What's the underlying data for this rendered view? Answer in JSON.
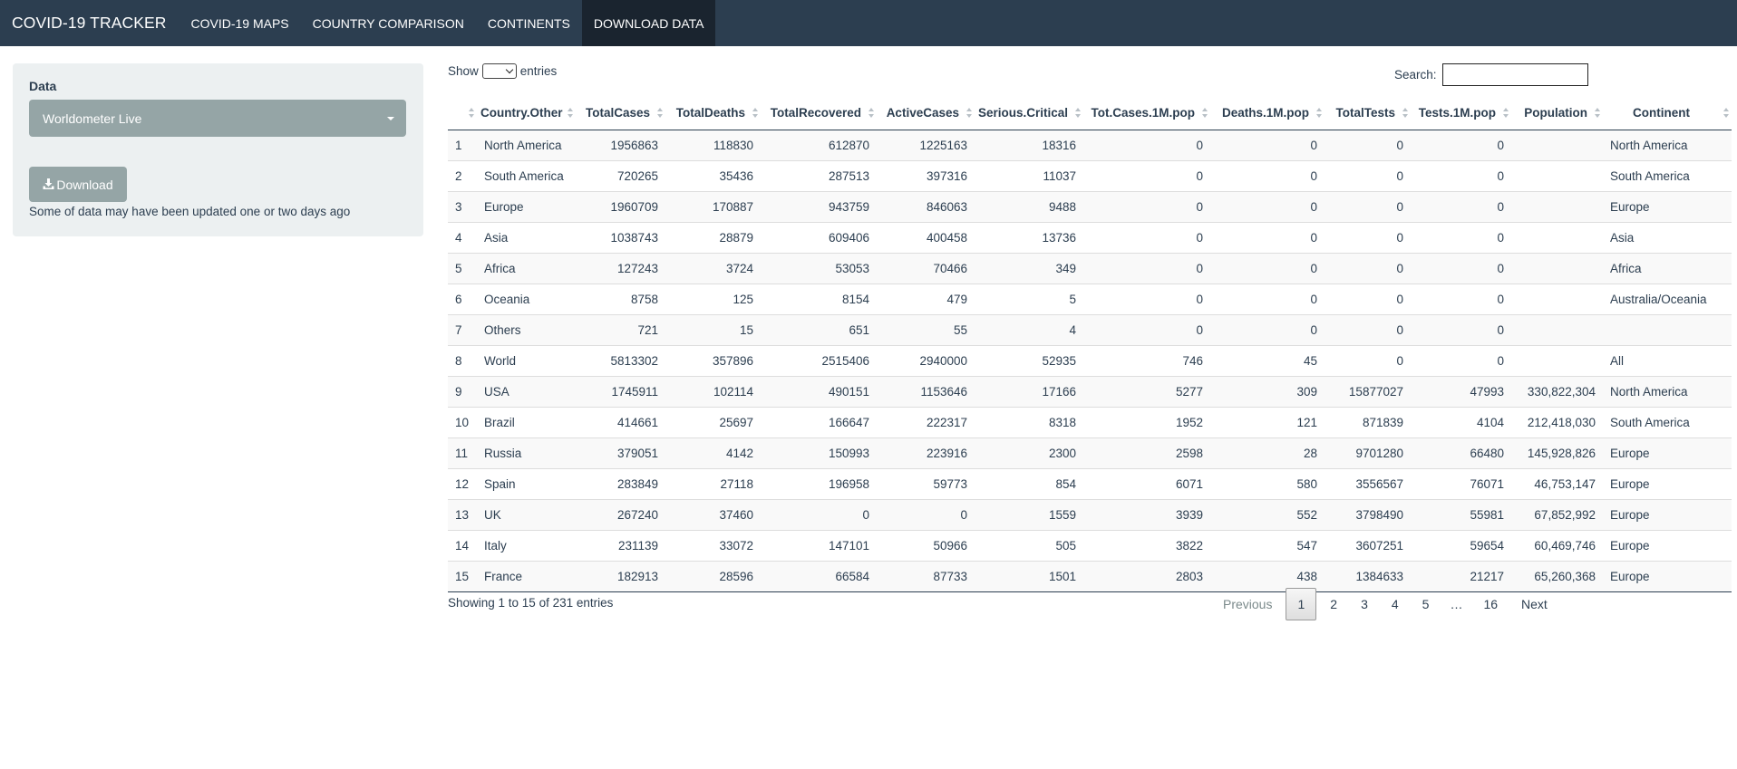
{
  "navbar": {
    "brand": "COVID-19 TRACKER",
    "items": [
      "COVID-19 MAPS",
      "COUNTRY COMPARISON",
      "CONTINENTS",
      "DOWNLOAD DATA"
    ],
    "active": "DOWNLOAD DATA"
  },
  "sidebar": {
    "data_label": "Data",
    "select_value": "Worldometer Live",
    "download_label": "Download",
    "download_icon": "download-icon",
    "note": "Some of data may have been updated one or two days ago"
  },
  "table_controls": {
    "show_label": "Show",
    "entries_label": "entries",
    "search_label": "Search:"
  },
  "table": {
    "columns": [
      "",
      "Country.Other",
      "TotalCases",
      "TotalDeaths",
      "TotalRecovered",
      "ActiveCases",
      "Serious.Critical",
      "Tot.Cases.1M.pop",
      "Deaths.1M.pop",
      "TotalTests",
      "Tests.1M.pop",
      "Population",
      "Continent"
    ],
    "rows": [
      [
        "1",
        "North America",
        "1956863",
        "118830",
        "612870",
        "1225163",
        "18316",
        "0",
        "0",
        "0",
        "0",
        "",
        "North America"
      ],
      [
        "2",
        "South America",
        "720265",
        "35436",
        "287513",
        "397316",
        "11037",
        "0",
        "0",
        "0",
        "0",
        "",
        "South America"
      ],
      [
        "3",
        "Europe",
        "1960709",
        "170887",
        "943759",
        "846063",
        "9488",
        "0",
        "0",
        "0",
        "0",
        "",
        "Europe"
      ],
      [
        "4",
        "Asia",
        "1038743",
        "28879",
        "609406",
        "400458",
        "13736",
        "0",
        "0",
        "0",
        "0",
        "",
        "Asia"
      ],
      [
        "5",
        "Africa",
        "127243",
        "3724",
        "53053",
        "70466",
        "349",
        "0",
        "0",
        "0",
        "0",
        "",
        "Africa"
      ],
      [
        "6",
        "Oceania",
        "8758",
        "125",
        "8154",
        "479",
        "5",
        "0",
        "0",
        "0",
        "0",
        "",
        "Australia/Oceania"
      ],
      [
        "7",
        "Others",
        "721",
        "15",
        "651",
        "55",
        "4",
        "0",
        "0",
        "0",
        "0",
        "",
        ""
      ],
      [
        "8",
        "World",
        "5813302",
        "357896",
        "2515406",
        "2940000",
        "52935",
        "746",
        "45",
        "0",
        "0",
        "",
        "All"
      ],
      [
        "9",
        "USA",
        "1745911",
        "102114",
        "490151",
        "1153646",
        "17166",
        "5277",
        "309",
        "15877027",
        "47993",
        "330,822,304",
        "North America"
      ],
      [
        "10",
        "Brazil",
        "414661",
        "25697",
        "166647",
        "222317",
        "8318",
        "1952",
        "121",
        "871839",
        "4104",
        "212,418,030",
        "South America"
      ],
      [
        "11",
        "Russia",
        "379051",
        "4142",
        "150993",
        "223916",
        "2300",
        "2598",
        "28",
        "9701280",
        "66480",
        "145,928,826",
        "Europe"
      ],
      [
        "12",
        "Spain",
        "283849",
        "27118",
        "196958",
        "59773",
        "854",
        "6071",
        "580",
        "3556567",
        "76071",
        "46,753,147",
        "Europe"
      ],
      [
        "13",
        "UK",
        "267240",
        "37460",
        "0",
        "0",
        "1559",
        "3939",
        "552",
        "3798490",
        "55981",
        "67,852,992",
        "Europe"
      ],
      [
        "14",
        "Italy",
        "231139",
        "33072",
        "147101",
        "50966",
        "505",
        "3822",
        "547",
        "3607251",
        "59654",
        "60,469,746",
        "Europe"
      ],
      [
        "15",
        "France",
        "182913",
        "28596",
        "66584",
        "87733",
        "1501",
        "2803",
        "438",
        "1384633",
        "21217",
        "65,260,368",
        "Europe"
      ]
    ]
  },
  "footer": {
    "info": "Showing 1 to 15 of 231 entries",
    "pagination": {
      "previous": "Previous",
      "pages": [
        "1",
        "2",
        "3",
        "4",
        "5"
      ],
      "ellipsis": "…",
      "last": "16",
      "next": "Next",
      "current": "1"
    }
  }
}
